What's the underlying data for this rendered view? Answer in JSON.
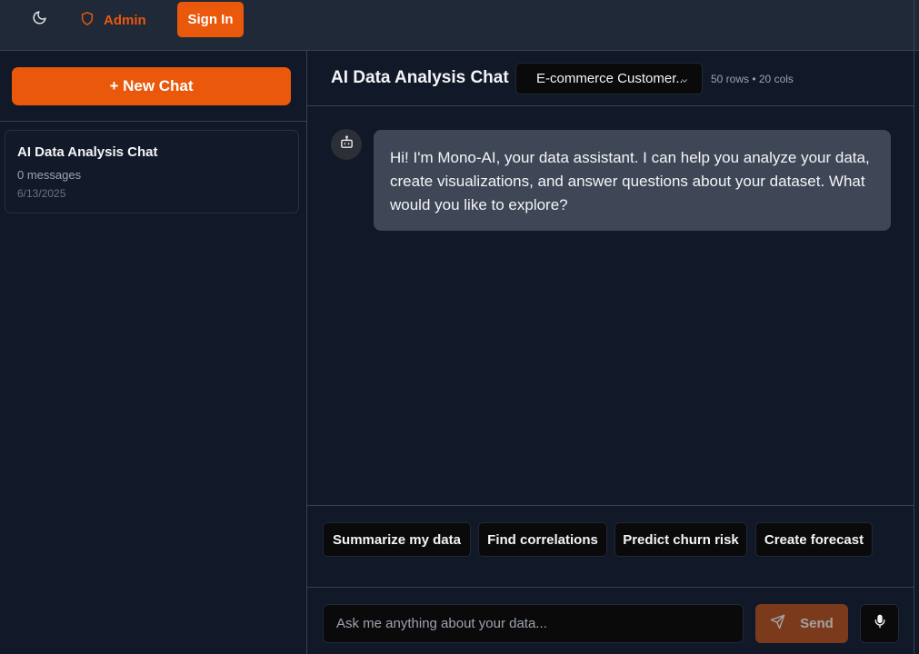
{
  "header": {
    "admin_label": "Admin",
    "signin_label": "Sign In",
    "theme_icon": "moon-icon",
    "admin_icon": "shield-icon",
    "accent_color": "#ea580c"
  },
  "sidebar": {
    "new_chat_label": "+ New Chat",
    "chats": [
      {
        "title": "AI Data Analysis Chat",
        "messages": "0 messages",
        "date": "6/13/2025"
      }
    ]
  },
  "chat": {
    "title": "AI Data Analysis Chat",
    "dataset": {
      "selected": "E-commerce Customer...",
      "meta": "50 rows • 20 cols"
    },
    "messages": [
      {
        "role": "assistant",
        "avatar_icon": "bot-icon",
        "text": "Hi! I'm Mono-AI, your data assistant. I can help you analyze your data, create visualizations, and answer questions about your dataset. What would you like to explore?"
      }
    ],
    "suggestions": [
      "Summarize my data",
      "Find correlations",
      "Predict churn risk",
      "Create forecast"
    ],
    "input": {
      "placeholder": "Ask me anything about your data...",
      "value": ""
    },
    "send_label": "Send",
    "send_icon": "send-icon",
    "mic_icon": "microphone-icon"
  }
}
